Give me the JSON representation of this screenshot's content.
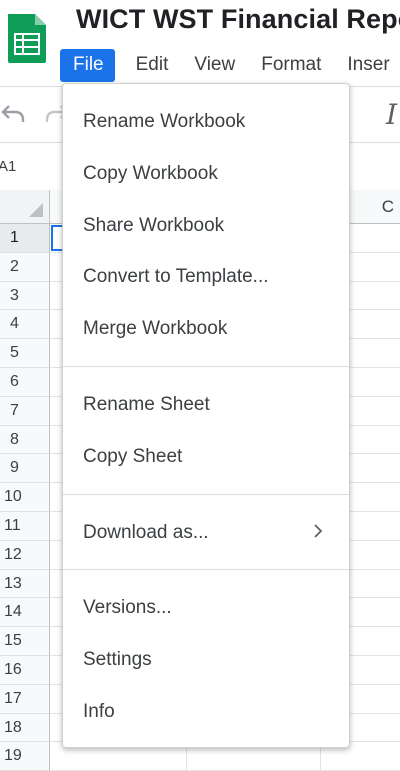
{
  "header": {
    "title": "WICT WST Financial Repo",
    "app_icon": "sheets-icon",
    "brand_color": "#0f9d58"
  },
  "menubar": {
    "items": [
      {
        "label": "File",
        "active": true
      },
      {
        "label": "Edit"
      },
      {
        "label": "View"
      },
      {
        "label": "Format"
      },
      {
        "label": "Inser"
      }
    ],
    "accent_color": "#1a73e8"
  },
  "toolbar": {
    "icons": [
      "undo-icon",
      "redo-icon",
      "italic-icon"
    ],
    "italic_label": "I"
  },
  "name_box": {
    "value": "A1"
  },
  "grid": {
    "col_headers": [
      "C"
    ],
    "row_headers": [
      "1",
      "2",
      "3",
      "4",
      "5",
      "6",
      "7",
      "8",
      "9",
      "10",
      "11",
      "12",
      "13",
      "14",
      "15",
      "16",
      "17",
      "18",
      "19"
    ],
    "selected_cell": "A1"
  },
  "file_menu": {
    "groups": [
      [
        {
          "label": "Rename Workbook"
        },
        {
          "label": "Copy Workbook"
        },
        {
          "label": "Share Workbook"
        },
        {
          "label": "Convert to Template..."
        },
        {
          "label": "Merge Workbook"
        }
      ],
      [
        {
          "label": "Rename Sheet"
        },
        {
          "label": "Copy Sheet"
        }
      ],
      [
        {
          "label": "Download as...",
          "submenu": true,
          "submenu_icon": "chevron-right-icon"
        }
      ],
      [
        {
          "label": "Versions..."
        },
        {
          "label": "Settings"
        },
        {
          "label": "Info"
        }
      ]
    ]
  }
}
